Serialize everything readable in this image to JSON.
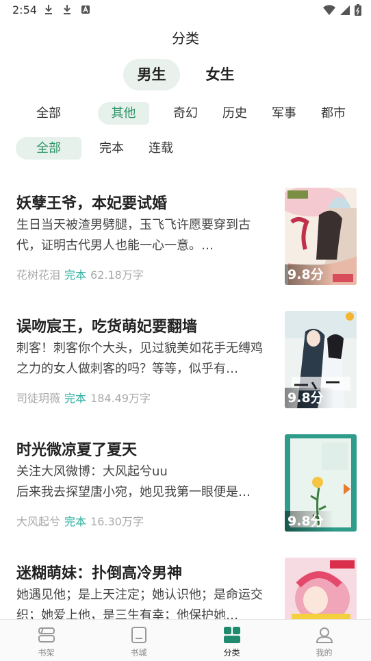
{
  "status_bar": {
    "time": "2:54"
  },
  "header": {
    "title": "分类"
  },
  "gender_tabs": [
    {
      "label": "男生",
      "active": true
    },
    {
      "label": "女生",
      "active": false
    }
  ],
  "category_filters": [
    {
      "label": "全部",
      "active": false
    },
    {
      "label": "其他",
      "active": true
    },
    {
      "label": "奇幻"
    },
    {
      "label": "历史"
    },
    {
      "label": "军事"
    },
    {
      "label": "都市"
    }
  ],
  "status_filters": [
    {
      "label": "全部",
      "active": true
    },
    {
      "label": "完本"
    },
    {
      "label": "连载"
    }
  ],
  "books": [
    {
      "title": "妖孽王爷，本妃要试婚",
      "desc": "生日当天被渣男劈腿，玉飞飞许愿要穿到古代，证明古代男人也能一心一意。…",
      "author": "花树花泪",
      "status": "完本",
      "words": "62.18万字",
      "score": "9.8分"
    },
    {
      "title": "误吻宸王，吃货萌妃要翻墙",
      "desc": "刺客！刺客你个大头，见过貌美如花手无缚鸡之力的女人做刺客的吗？等等，似乎有…",
      "author": "司徒玥薇",
      "status": "完本",
      "words": "184.49万字",
      "score": "9.8分"
    },
    {
      "title": "时光微凉夏了夏天",
      "desc": "关注大风微博：大风起兮uu\n后来我去探望唐小宛，她见我第一眼便是…",
      "author": "大风起兮",
      "status": "完本",
      "words": "16.30万字",
      "score": "9.8分"
    },
    {
      "title": "迷糊萌妹：扑倒高冷男神",
      "desc": "她遇见他；是上天注定；她认识他；是命运交织；她爱上他，是三生有幸；他保护她…",
      "author": "",
      "status": "",
      "words": "",
      "score": ""
    }
  ],
  "bottom_nav": [
    {
      "label": "书架",
      "icon": "bookshelf-icon",
      "active": false
    },
    {
      "label": "书城",
      "icon": "bookstore-icon",
      "active": false
    },
    {
      "label": "分类",
      "icon": "category-icon",
      "active": true
    },
    {
      "label": "我的",
      "icon": "profile-icon",
      "active": false
    }
  ],
  "colors": {
    "accent": "#2d9467",
    "chip_bg": "#e6f1ec",
    "status_teal": "#2bb0a0"
  }
}
